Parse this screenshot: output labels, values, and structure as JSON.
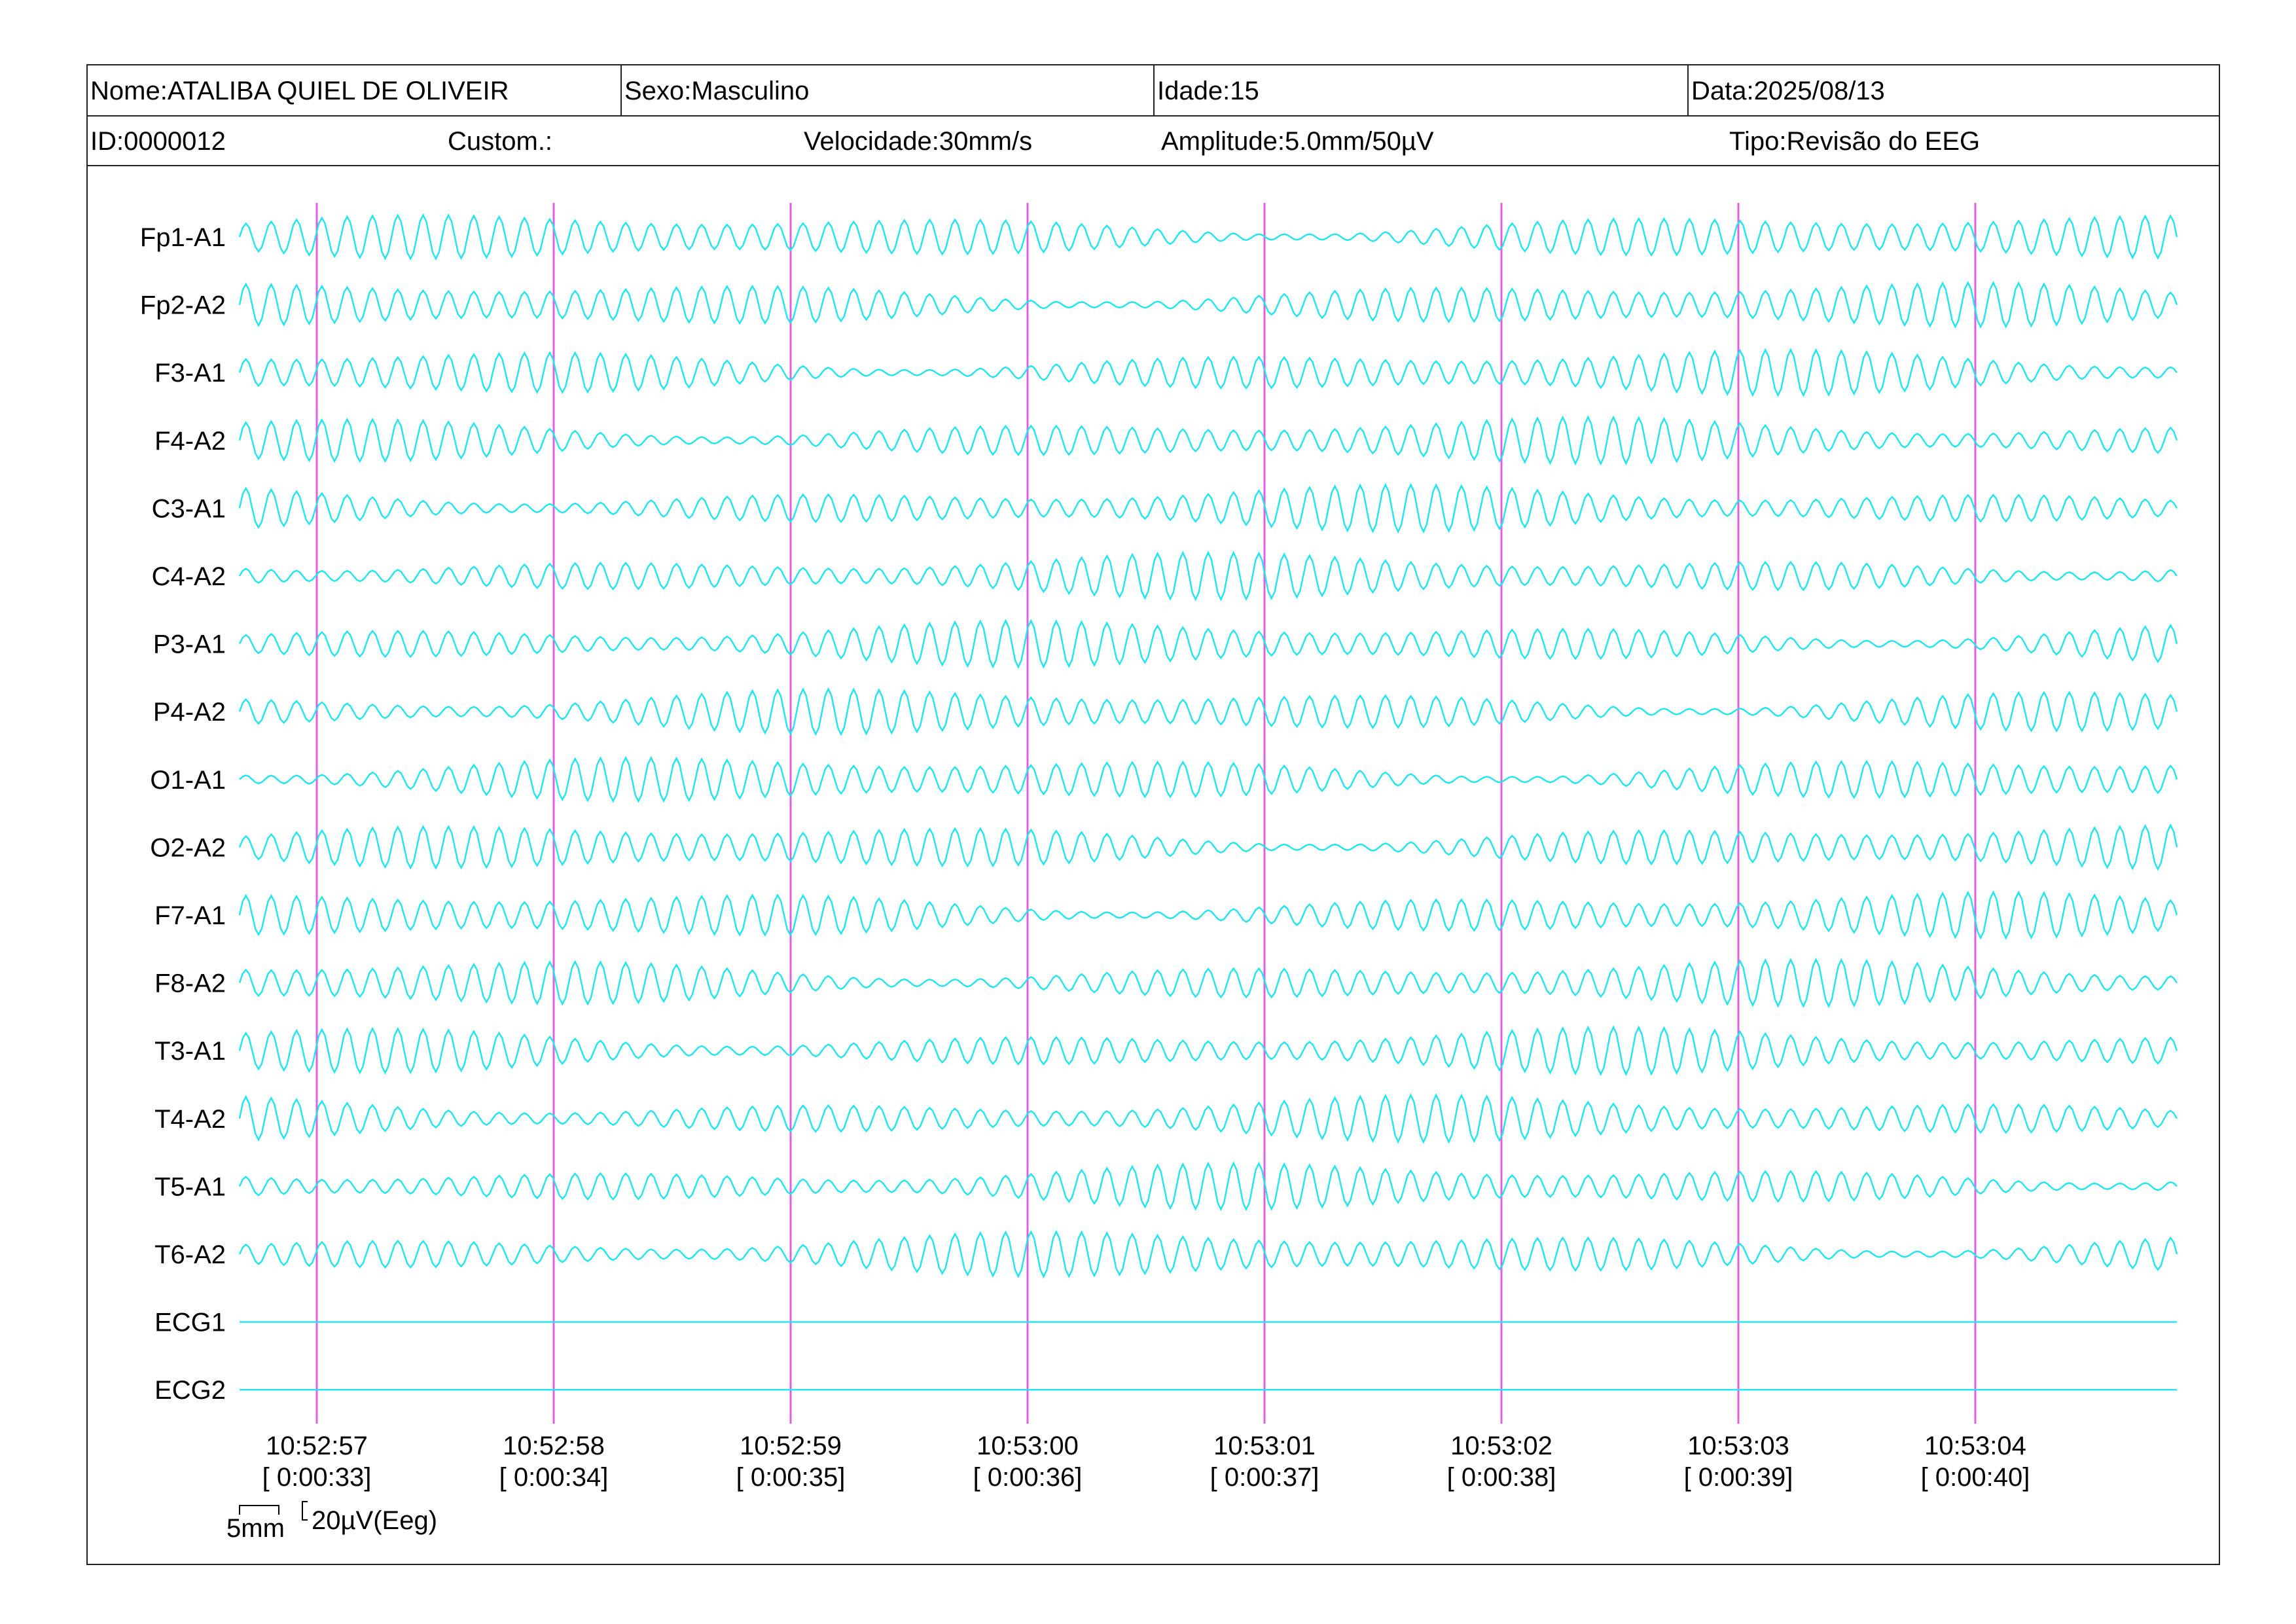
{
  "header": {
    "nome": "Nome:ATALIBA QUIEL DE OLIVEIR",
    "sexo": "Sexo:Masculino",
    "idade": "Idade:15",
    "data": "Data:2025/08/13",
    "id": "ID:0000012",
    "custom": "Custom.:",
    "velocidade": "Velocidade:30mm/s",
    "amplitude": "Amplitude:5.0mm/50µV",
    "tipo": "Tipo:Revisão do EEG"
  },
  "colors": {
    "trace": "#1ee6f0",
    "marker": "#e060e0",
    "border": "#222222"
  },
  "chart_data": {
    "type": "line",
    "channels": [
      "Fp1-A1",
      "Fp2-A2",
      "F3-A1",
      "F4-A2",
      "C3-A1",
      "C4-A2",
      "P3-A1",
      "P4-A2",
      "O1-A1",
      "O2-A2",
      "F7-A1",
      "F8-A2",
      "T3-A1",
      "T4-A2",
      "T5-A1",
      "T6-A2",
      "ECG1",
      "ECG2"
    ],
    "ecg_flat": [
      "ECG1",
      "ECG2"
    ],
    "dominant_rhythm_hz": 9,
    "time_span_s": [
      32.33,
      40.83
    ],
    "markers": [
      {
        "clock": "10:52:57",
        "elapsed": "[ 0:00:33]"
      },
      {
        "clock": "10:52:58",
        "elapsed": "[ 0:00:34]"
      },
      {
        "clock": "10:52:59",
        "elapsed": "[ 0:00:35]"
      },
      {
        "clock": "10:53:00",
        "elapsed": "[ 0:00:36]"
      },
      {
        "clock": "10:53:01",
        "elapsed": "[ 0:00:37]"
      },
      {
        "clock": "10:53:02",
        "elapsed": "[ 0:00:38]"
      },
      {
        "clock": "10:53:03",
        "elapsed": "[ 0:00:39]"
      },
      {
        "clock": "10:53:04",
        "elapsed": "[ 0:00:40]"
      }
    ],
    "scale_bar": {
      "time_label": "5mm",
      "amp_label": "20µV(Eeg)"
    }
  }
}
